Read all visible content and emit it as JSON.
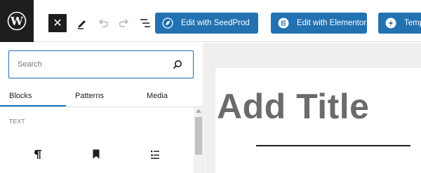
{
  "toolbar": {
    "close_glyph": "✕",
    "buttons": [
      {
        "label": "Edit with SeedProd",
        "icon": "seedprod-leaf-icon"
      },
      {
        "label": "Edit with Elementor",
        "icon": "elementor-icon"
      },
      {
        "label": "Templa",
        "icon": "templates-s-icon"
      }
    ]
  },
  "inserter": {
    "search": {
      "placeholder": "Search",
      "value": ""
    },
    "tabs": [
      "Blocks",
      "Patterns",
      "Media"
    ],
    "active_tab": "Blocks",
    "section_title": "TEXT",
    "block_icons": [
      "paragraph-icon",
      "heading-bookmark-icon",
      "list-icon"
    ]
  },
  "canvas": {
    "title_placeholder": "Add Title"
  },
  "colors": {
    "accent": "#2271b1",
    "dark": "#1e1e1e",
    "canvas_bg": "#f0efee",
    "title_gray": "#6b6b6b"
  }
}
